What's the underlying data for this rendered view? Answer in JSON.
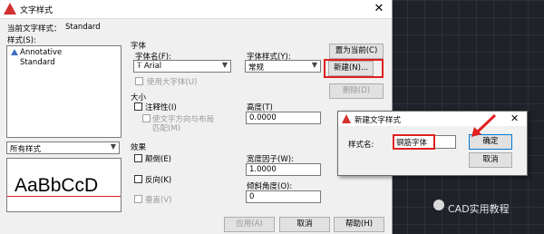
{
  "main_dialog": {
    "title": "文字样式",
    "close_glyph": "✕",
    "current_style_label": "当前文字样式：",
    "current_style_value": "Standard",
    "styles_label": "样式(S):",
    "styles": [
      "Annotative",
      "Standard"
    ],
    "filter_value": "所有样式",
    "preview_text": "AaBbCcD",
    "font_group": {
      "title": "字体",
      "font_name_label": "字体名(F):",
      "font_name_value": "Arial",
      "font_style_label": "字体样式(Y):",
      "font_style_value": "常规",
      "big_font_label": "使用大字体(U)"
    },
    "size_group": {
      "title": "大小",
      "annotative_label": "注释性(I)",
      "match_orientation_label": "使文字方向与布局",
      "match_orientation_label2": "匹配(M)",
      "height_label": "高度(T)",
      "height_value": "0.0000"
    },
    "effects_group": {
      "title": "效果",
      "upside_down_label": "颠倒(E)",
      "backwards_label": "反向(K)",
      "vertical_label": "垂直(V)",
      "width_factor_label": "宽度因子(W):",
      "width_factor_value": "1.0000",
      "oblique_label": "倾斜角度(O):",
      "oblique_value": "0"
    },
    "buttons": {
      "set_current": "置为当前(C)",
      "new": "新建(N)...",
      "delete": "删除(D)",
      "apply": "应用(A)",
      "cancel": "取消",
      "help": "帮助(H)"
    }
  },
  "new_style_dialog": {
    "title": "新建文字样式",
    "close_glyph": "✕",
    "name_label": "样式名:",
    "name_value": "钢筋字体",
    "ok": "确定",
    "cancel": "取消"
  },
  "watermark": "CAD实用教程",
  "colors": {
    "highlight": "#e0201f",
    "logo": "#d32f2f"
  }
}
